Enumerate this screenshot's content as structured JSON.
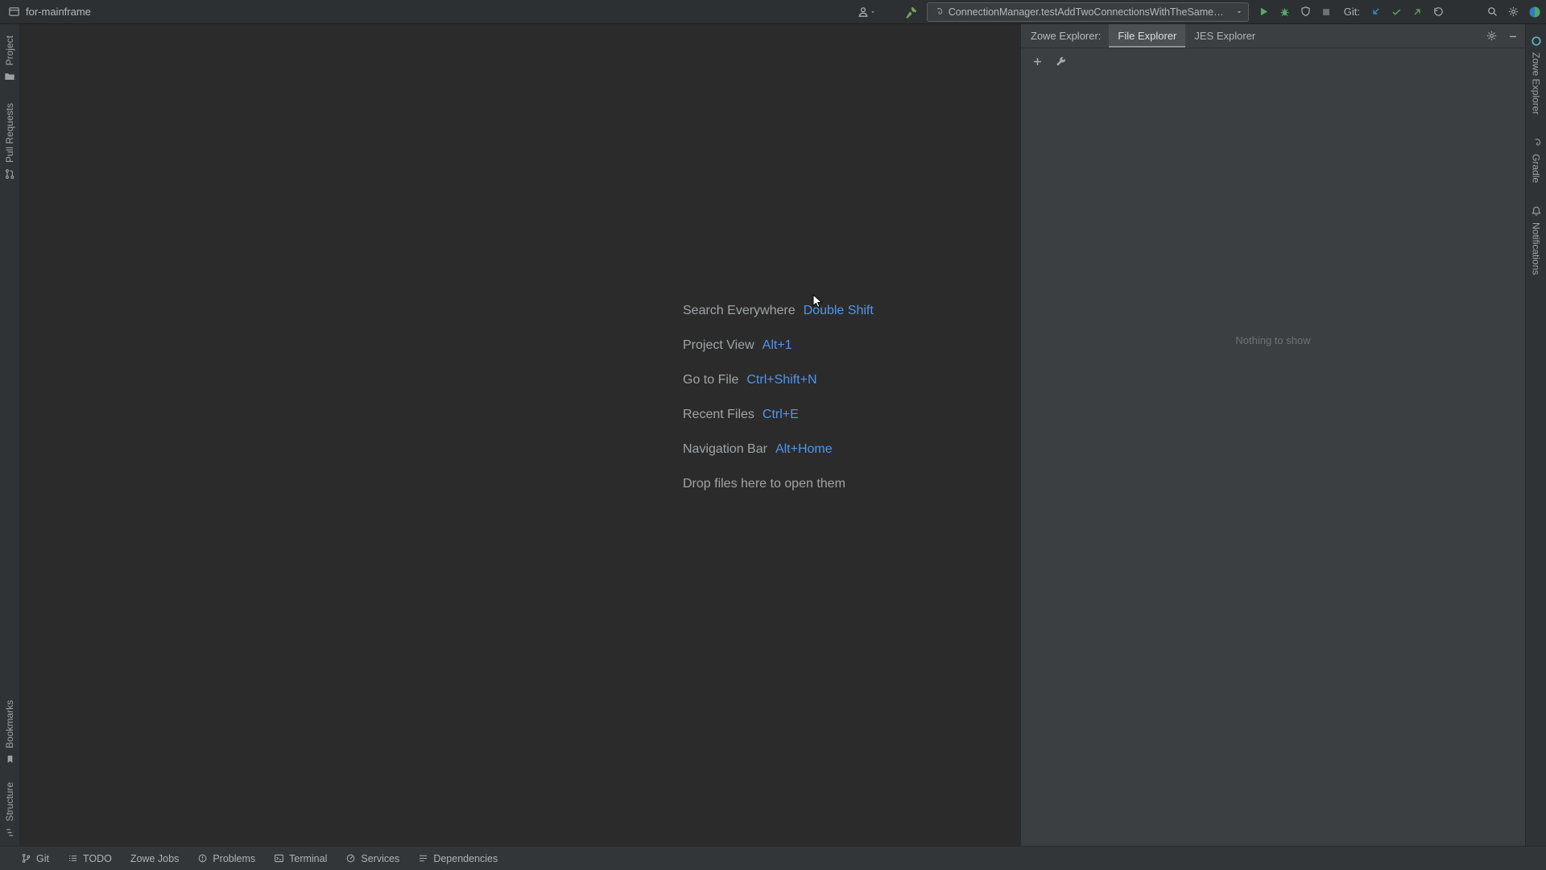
{
  "colors": {
    "accent": "#5394ec",
    "run_green": "#59a869",
    "update_blue": "#3d94d9",
    "icon_gray": "#a9acae",
    "editor_bg": "#2b2b2b",
    "panel_bg": "#3c3f41",
    "titlebar_bg": "#2d3032",
    "statusbar_bg": "#333638",
    "stripe_bg": "#303335"
  },
  "titlebar": {
    "project": "for-mainframe",
    "run_config": "ConnectionManager.testAddTwoConnectionsWithTheSameName",
    "git_label": "Git:"
  },
  "left_stripe": {
    "top": [
      {
        "label": "Project"
      },
      {
        "label": "Pull Requests"
      }
    ],
    "bottom": [
      {
        "label": "Bookmarks"
      },
      {
        "label": "Structure"
      }
    ]
  },
  "editor": {
    "hints": [
      {
        "label": "Search Everywhere",
        "shortcut": "Double Shift"
      },
      {
        "label": "Project View",
        "shortcut": "Alt+1"
      },
      {
        "label": "Go to File",
        "shortcut": "Ctrl+Shift+N"
      },
      {
        "label": "Recent Files",
        "shortcut": "Ctrl+E"
      },
      {
        "label": "Navigation Bar",
        "shortcut": "Alt+Home"
      },
      {
        "label": "Drop files here to open them",
        "shortcut": ""
      }
    ]
  },
  "zowe_panel": {
    "title": "Zowe Explorer:",
    "tabs": [
      {
        "label": "File Explorer",
        "selected": true
      },
      {
        "label": "JES Explorer",
        "selected": false
      }
    ],
    "empty_text": "Nothing to show"
  },
  "right_stripe": {
    "items": [
      {
        "label": "Zowe Explorer"
      },
      {
        "label": "Gradle"
      },
      {
        "label": "Notifications"
      }
    ]
  },
  "statusbar": {
    "items": [
      {
        "label": "Git"
      },
      {
        "label": "TODO"
      },
      {
        "label": "Zowe Jobs"
      },
      {
        "label": "Problems"
      },
      {
        "label": "Terminal"
      },
      {
        "label": "Services"
      },
      {
        "label": "Dependencies"
      }
    ]
  }
}
